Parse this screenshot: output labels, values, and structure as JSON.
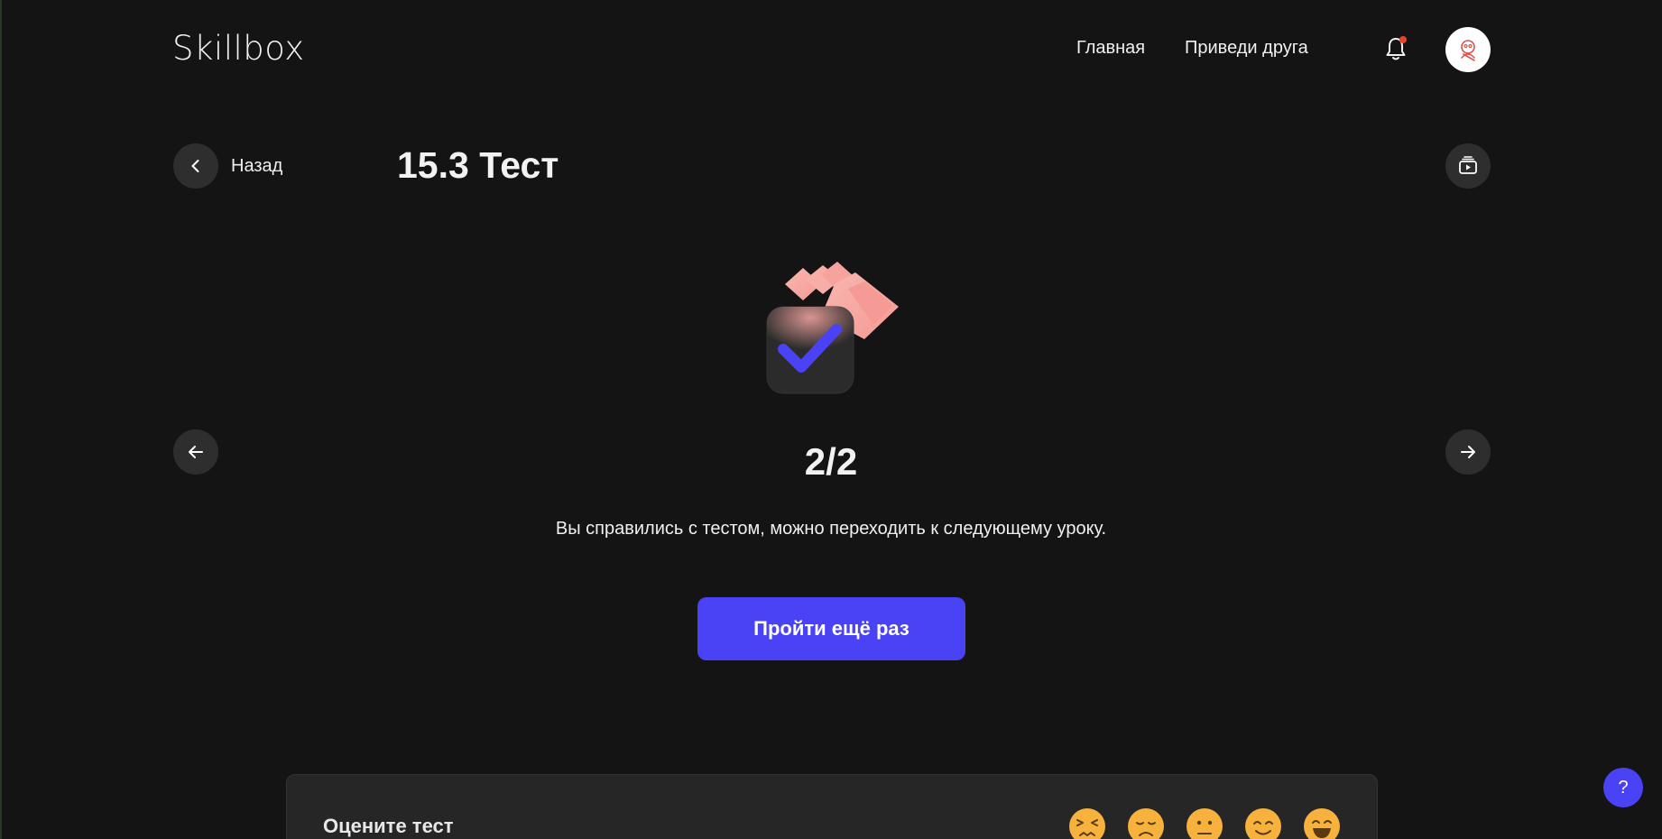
{
  "header": {
    "logo": "Skillbox",
    "nav": [
      {
        "label": "Главная"
      },
      {
        "label": "Приведи друга"
      }
    ],
    "has_notification": true
  },
  "lesson": {
    "back_label": "Назад",
    "title": "15.3 Тест"
  },
  "result": {
    "score": "2/2",
    "message": "Вы справились с тестом, можно переходить к следующему уроку.",
    "retry_label": "Пройти ещё раз"
  },
  "rating": {
    "label": "Оцените тест",
    "emojis": [
      "angry",
      "sad",
      "neutral",
      "smile",
      "happy"
    ]
  },
  "help": {
    "label": "?"
  },
  "colors": {
    "background": "#141414",
    "accent": "#4a43f5",
    "notification_dot": "#e8432b",
    "illustration_pink": "#f7a8a3",
    "emoji_yellow": "#f6b23c"
  }
}
